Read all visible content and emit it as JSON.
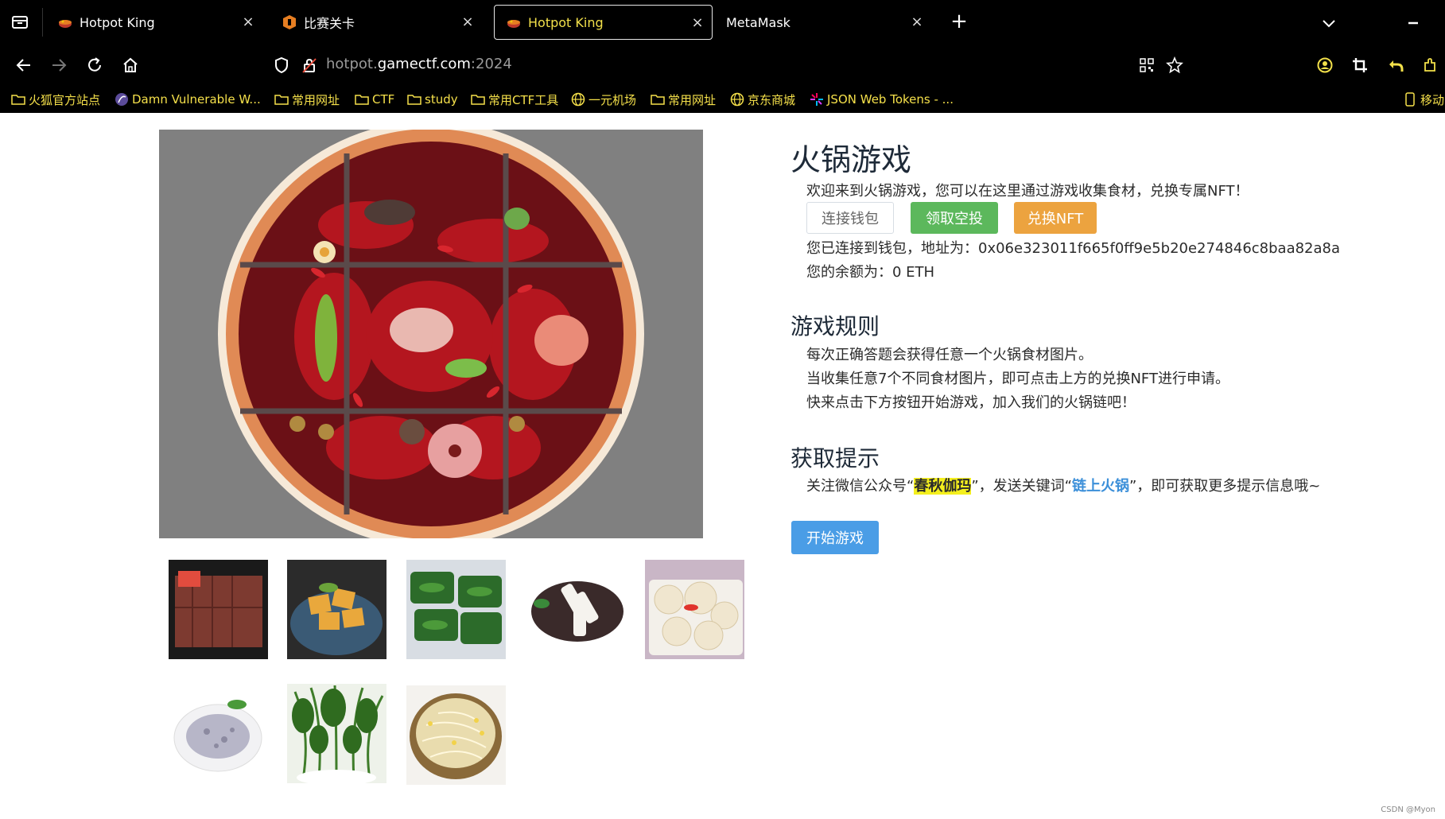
{
  "browser": {
    "tabs": [
      {
        "title": "Hotpot King",
        "active": false
      },
      {
        "title": "比赛关卡",
        "active": false
      },
      {
        "title": "Hotpot King",
        "active": true
      },
      {
        "title": "MetaMask",
        "active": false
      }
    ],
    "close_glyph": "×",
    "new_tab_glyph": "+",
    "url_prefix": "hotpot.",
    "url_host": "gamectf.com",
    "url_port": ":2024",
    "bookmarks": [
      "火狐官方站点",
      "Damn Vulnerable W...",
      "常用网址",
      "CTF",
      "study",
      "常用CTF工具",
      "一元机场",
      "常用网址",
      "京东商城",
      "JSON Web Tokens - ..."
    ],
    "mobile_bookmarks": "移动"
  },
  "page": {
    "title": "火锅游戏",
    "welcome": "欢迎来到火锅游戏，您可以在这里通过游戏收集食材，兑换专属NFT！",
    "buttons": {
      "connect": "连接钱包",
      "airdrop": "领取空投",
      "redeem": "兑换NFT",
      "start": "开始游戏"
    },
    "wallet_line": "您已连接到钱包，地址为：0x06e323011f665f0ff9e5b20e274846c8baa82a8a",
    "balance_line": "您的余额为：0 ETH",
    "rules_title": "游戏规则",
    "rules": [
      "每次正确答题会获得任意一个火锅食材图片。",
      "当收集任意7个不同食材图片，即可点击上方的兑换NFT进行申请。",
      "快来点击下方按钮开始游戏，加入我们的火锅链吧！"
    ],
    "hint_title": "获取提示",
    "hint_pre": "关注微信公众号“",
    "hint_kw1": "春秋伽玛",
    "hint_mid": "”，发送关键词“",
    "hint_kw2": "链上火锅",
    "hint_post": "”，即可获取更多提示信息哦~",
    "watermark": "CSDN @Myon⁠"
  },
  "colors": {
    "accent_yellow": "#f2e04a",
    "green": "#5cb85c",
    "orange": "#eca33f",
    "blue": "#4a9de6"
  }
}
